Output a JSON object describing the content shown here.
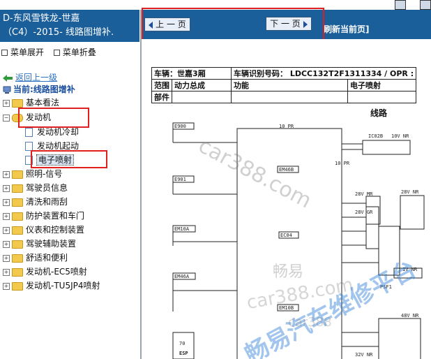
{
  "left_panel": {
    "title_line1": "D-东风雪铁龙-世嘉",
    "title_line2": "（C4）-2015- 线路图增补.",
    "expand_label": "菜单展开",
    "collapse_label": "菜单折叠",
    "back_label": "返回上一级",
    "current_label": "当前:线路图增补"
  },
  "tree": {
    "items": [
      {
        "label": "基本看法"
      },
      {
        "label": "发动机"
      },
      {
        "label": "发动机冷却"
      },
      {
        "label": "发动机起动"
      },
      {
        "label": "电子喷射"
      },
      {
        "label": "照明-信号"
      },
      {
        "label": "驾驶员信息"
      },
      {
        "label": "清洗和雨刮"
      },
      {
        "label": "防护装置和车门"
      },
      {
        "label": "仪表和控制装置"
      },
      {
        "label": "驾驶辅助装置"
      },
      {
        "label": "舒适和便利"
      },
      {
        "label": "发动机-EC5喷射"
      },
      {
        "label": "发动机-TU5JP4喷射"
      }
    ]
  },
  "toolbar": {
    "prev_label": "上 一 页",
    "next_label": "下 一 页",
    "refresh_label": "刷新当前页]"
  },
  "document": {
    "vehicle_label": "车辆：世嘉3厢",
    "vin_label": "车辆识别号码： LDCC132T2F1311334 / OPR :",
    "row2": [
      "范围",
      "动力总成",
      "功能",
      "电子喷射"
    ],
    "row3_label": "部件",
    "diagram_title": "线路",
    "connectors": {
      "e900": "E900",
      "e901": "E901",
      "em10a": "EM10A",
      "em46a": "EM46A",
      "em46b": "EM46B",
      "ec04": "EC04",
      "em10b": "EM10B",
      "ic02b": "IC02B",
      "psf1": "PSF1",
      "top_pr": "10 PR",
      "pr_mid": "10 PR",
      "v28mr": "28V MR",
      "v28gr": "28V GR",
      "v28nr": "28V NR",
      "v10nr": "10V NR",
      "v1nr": "1V NR",
      "v48nr": "48V NR",
      "v32nr": "32V NR",
      "esp": "ESP",
      "esp_num": "70"
    },
    "watermarks": [
      "car388.com",
      "畅易",
      "car388.com",
      "畅易汽车维修平台",
      "car388",
      "畅易汽车维修平台"
    ]
  },
  "colors": {
    "header_blue": "#1a5e9a",
    "red_highlight": "#e02020",
    "watermark_blue": "#2f7fd8"
  }
}
